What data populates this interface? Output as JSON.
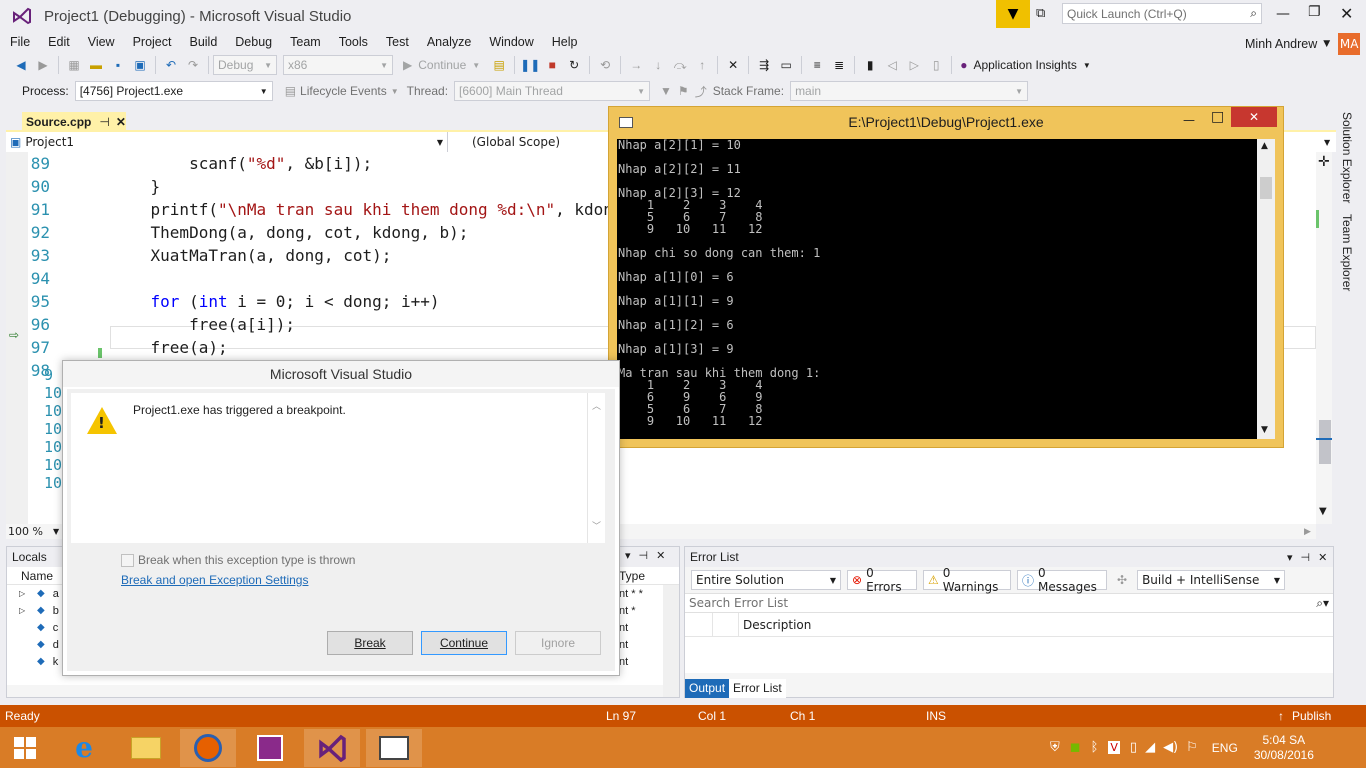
{
  "title": {
    "text": "Project1 (Debugging) - Microsoft Visual Studio",
    "quick_launch": "Quick Launch (Ctrl+Q)"
  },
  "menu": [
    "File",
    "Edit",
    "View",
    "Project",
    "Build",
    "Debug",
    "Team",
    "Tools",
    "Test",
    "Analyze",
    "Window",
    "Help"
  ],
  "user": {
    "name": "Minh Andrew",
    "initials": "MA"
  },
  "toolbar": {
    "config": "Debug",
    "platform": "x86",
    "continue": "Continue",
    "app_insights": "Application Insights"
  },
  "debugbar": {
    "process_label": "Process:",
    "process": "[4756] Project1.exe",
    "lifecycle": "Lifecycle Events",
    "thread_label": "Thread:",
    "thread": "[6600] Main Thread",
    "stack_label": "Stack Frame:",
    "stack": "main"
  },
  "editor": {
    "tab": "Source.cpp",
    "project": "Project1",
    "scope": "(Global Scope)",
    "zoom": "100 %",
    "lines": [
      {
        "n": "89",
        "indent": "        ",
        "parts": [
          [
            "scanf(",
            ""
          ],
          [
            "\"%d\"",
            "str"
          ],
          [
            ", &b[i]);",
            ""
          ]
        ]
      },
      {
        "n": "90",
        "indent": "    ",
        "parts": [
          [
            "}",
            ""
          ]
        ]
      },
      {
        "n": "91",
        "indent": "    ",
        "parts": [
          [
            "printf(",
            ""
          ],
          [
            "\"\\nMa tran sau khi them dong %d:\\n\"",
            "str"
          ],
          [
            ", kdong);",
            ""
          ]
        ]
      },
      {
        "n": "92",
        "indent": "    ",
        "parts": [
          [
            "ThemDong(a, dong, cot, kdong, b);",
            ""
          ]
        ]
      },
      {
        "n": "93",
        "indent": "    ",
        "parts": [
          [
            "XuatMaTran(a, dong, cot);",
            ""
          ]
        ]
      },
      {
        "n": "94",
        "indent": "",
        "parts": []
      },
      {
        "n": "95",
        "indent": "    ",
        "parts": [
          [
            "for",
            "kw"
          ],
          [
            " (",
            ""
          ],
          [
            "int",
            "kw"
          ],
          [
            " i = 0; i < dong; i++)",
            ""
          ]
        ]
      },
      {
        "n": "96",
        "indent": "        ",
        "parts": [
          [
            "free(a[i]);",
            ""
          ]
        ]
      },
      {
        "n": "97",
        "indent": "    ",
        "parts": [
          [
            "free(a);",
            ""
          ]
        ]
      },
      {
        "n": "98",
        "indent": "",
        "parts": []
      }
    ],
    "hidden_lines": [
      "9",
      "10",
      "10",
      "10",
      "10",
      "10",
      "10"
    ]
  },
  "console": {
    "title": "E:\\Project1\\Debug\\Project1.exe",
    "lines": [
      "Nhap a[2][1] = 10",
      "",
      "Nhap a[2][2] = 11",
      "",
      "Nhap a[2][3] = 12",
      "    1    2    3    4",
      "    5    6    7    8",
      "    9   10   11   12",
      "",
      "Nhap chi so dong can them: 1",
      "",
      "Nhap a[1][0] = 6",
      "",
      "Nhap a[1][1] = 9",
      "",
      "Nhap a[1][2] = 6",
      "",
      "Nhap a[1][3] = 9",
      "",
      "Ma tran sau khi them dong 1:",
      "    1    2    3    4",
      "    6    9    6    9",
      "    5    6    7    8",
      "    9   10   11   12"
    ]
  },
  "dialog": {
    "title": "Microsoft Visual Studio",
    "message": "Project1.exe has triggered a breakpoint.",
    "checkbox": "Break when this exception type is thrown",
    "link": "Break and open Exception Settings",
    "break": "Break",
    "continue": "Continue",
    "ignore": "Ignore"
  },
  "locals": {
    "title": "Locals",
    "col_name": "Name",
    "col_type": "Type",
    "rows": [
      {
        "name": "a",
        "type": "nt * *"
      },
      {
        "name": "b",
        "type": "nt *"
      },
      {
        "name": "c",
        "type": "nt"
      },
      {
        "name": "d",
        "type": "nt"
      },
      {
        "name": "k",
        "type": "nt"
      }
    ]
  },
  "errorlist": {
    "title": "Error List",
    "scope": "Entire Solution",
    "errors": "0 Errors",
    "warnings": "0 Warnings",
    "messages": "0 Messages",
    "build": "Build + IntelliSense",
    "search": "Search Error List",
    "col_desc": "Description",
    "tab_output": "Output",
    "tab_errors": "Error List"
  },
  "side": {
    "solution_explorer": "Solution Explorer",
    "team_explorer": "Team Explorer"
  },
  "status": {
    "ready": "Ready",
    "ln": "Ln 97",
    "col": "Col 1",
    "ch": "Ch 1",
    "ins": "INS",
    "publish": "Publish",
    "color": "#ca5100"
  },
  "taskbar": {
    "lang": "ENG",
    "time": "5:04 SA",
    "date": "30/08/2016"
  }
}
